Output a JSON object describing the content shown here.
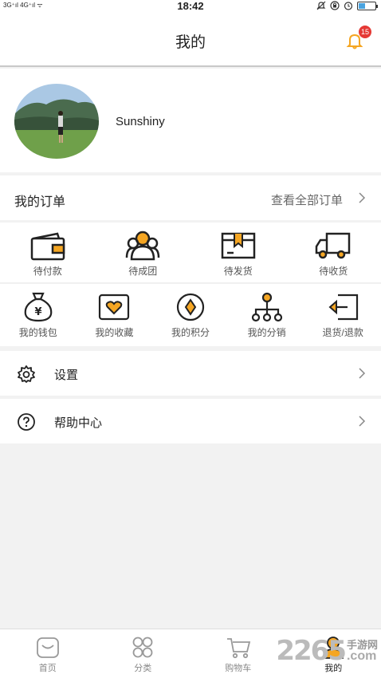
{
  "status_bar": {
    "left": "3G⁺ıl 4G⁺ıl ᯤ",
    "time": "18:42"
  },
  "header": {
    "title": "我的",
    "notification_count": "15"
  },
  "profile": {
    "username": "Sunshiny"
  },
  "orders": {
    "title": "我的订单",
    "view_all": "查看全部订单",
    "items": [
      {
        "label": "待付款",
        "icon": "wallet-icon"
      },
      {
        "label": "待成团",
        "icon": "group-icon"
      },
      {
        "label": "待发货",
        "icon": "package-icon"
      },
      {
        "label": "待收货",
        "icon": "truck-icon"
      }
    ]
  },
  "tools": {
    "items": [
      {
        "label": "我的钱包",
        "icon": "money-bag-icon"
      },
      {
        "label": "我的收藏",
        "icon": "heart-icon"
      },
      {
        "label": "我的积分",
        "icon": "points-icon"
      },
      {
        "label": "我的分销",
        "icon": "distribution-icon"
      },
      {
        "label": "退货/退款",
        "icon": "return-icon"
      }
    ]
  },
  "menu": {
    "settings": "设置",
    "help": "帮助中心"
  },
  "tabbar": {
    "items": [
      {
        "label": "首页",
        "icon": "home-icon"
      },
      {
        "label": "分类",
        "icon": "category-icon"
      },
      {
        "label": "购物车",
        "icon": "cart-icon"
      },
      {
        "label": "我的",
        "icon": "user-icon"
      }
    ],
    "active": "我的"
  },
  "watermark": {
    "number": "2265",
    "text": "手游网",
    "domain": ".com"
  },
  "colors": {
    "accent": "#f5a623",
    "badge": "#e53935",
    "icon_dark": "#222222"
  }
}
